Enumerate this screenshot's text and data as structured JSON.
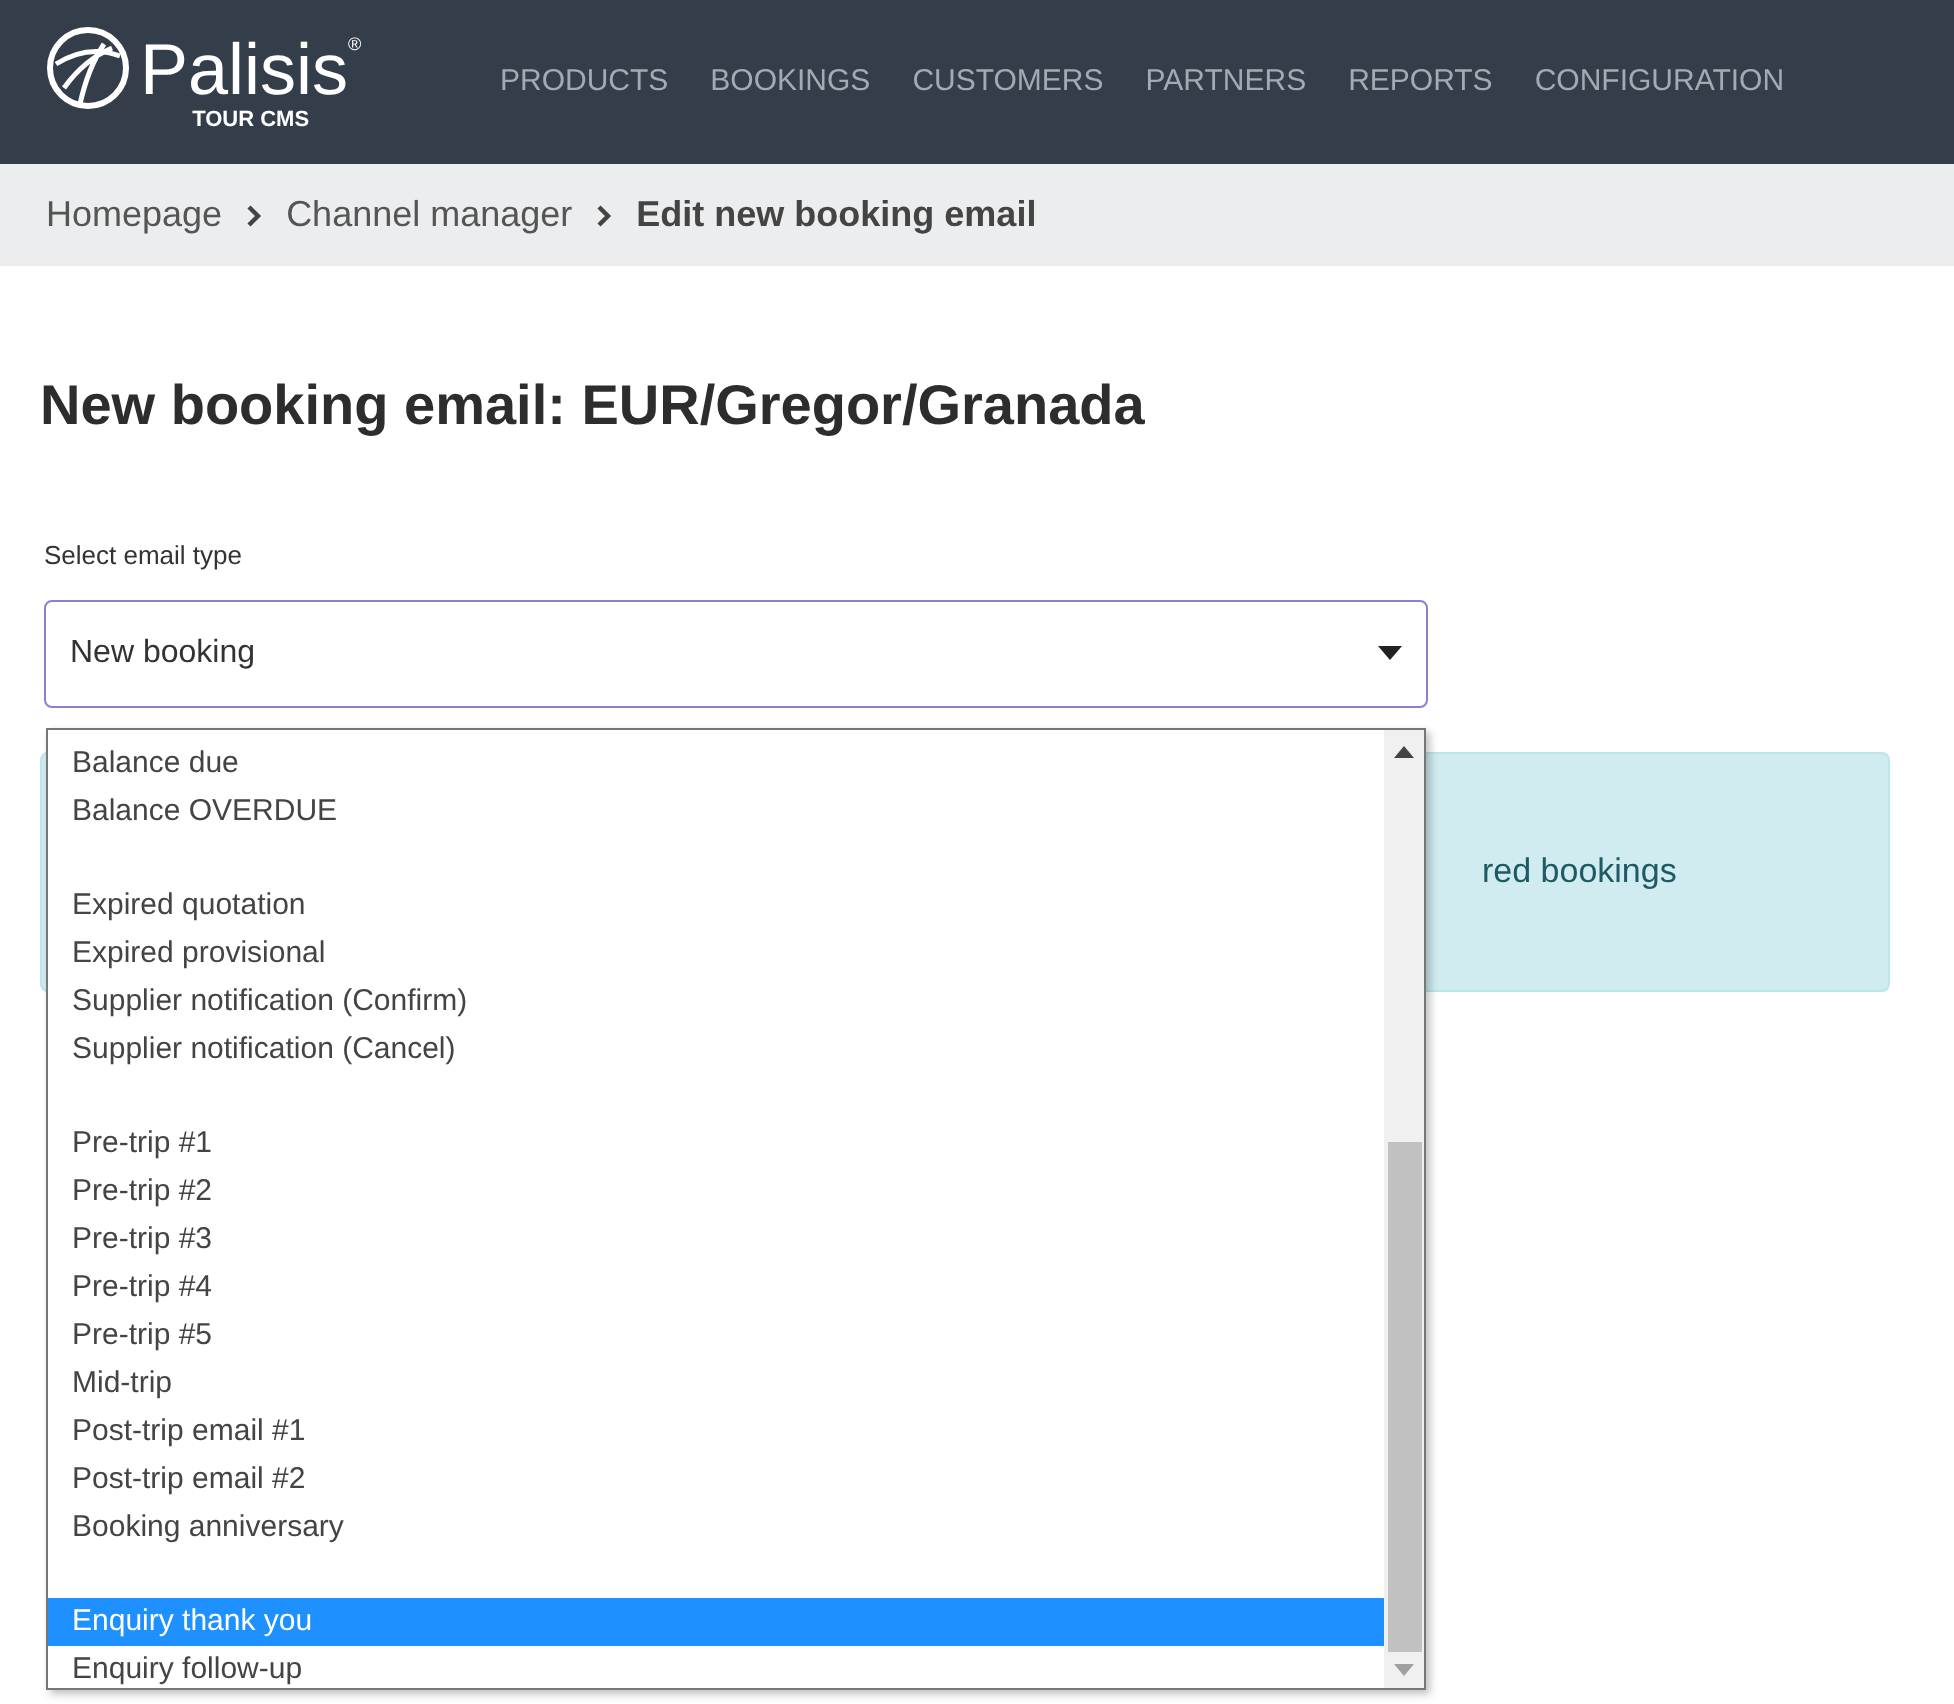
{
  "header": {
    "logo": {
      "name": "Palisis",
      "subtitle": "TOUR CMS",
      "mark": "®"
    },
    "nav": [
      {
        "label": "PRODUCTS"
      },
      {
        "label": "BOOKINGS"
      },
      {
        "label": "CUSTOMERS"
      },
      {
        "label": "PARTNERS"
      },
      {
        "label": "REPORTS"
      },
      {
        "label": "CONFIGURATION"
      }
    ]
  },
  "breadcrumb": [
    {
      "label": "Homepage",
      "current": false
    },
    {
      "label": "Channel manager",
      "current": false
    },
    {
      "label": "Edit new booking email",
      "current": true
    }
  ],
  "title": "New booking email: EUR/Gregor/Granada",
  "email_type": {
    "label": "Select email type",
    "value": "New booking",
    "expanded": true,
    "options": [
      {
        "kind": "option",
        "label": "Balance due",
        "selected": false
      },
      {
        "kind": "option",
        "label": "Balance OVERDUE",
        "selected": false
      },
      {
        "kind": "gap"
      },
      {
        "kind": "option",
        "label": "Expired quotation",
        "selected": false
      },
      {
        "kind": "option",
        "label": "Expired provisional",
        "selected": false
      },
      {
        "kind": "option",
        "label": "Supplier notification (Confirm)",
        "selected": false
      },
      {
        "kind": "option",
        "label": "Supplier notification (Cancel)",
        "selected": false
      },
      {
        "kind": "gap"
      },
      {
        "kind": "option",
        "label": "Pre-trip #1",
        "selected": false
      },
      {
        "kind": "option",
        "label": "Pre-trip #2",
        "selected": false
      },
      {
        "kind": "option",
        "label": "Pre-trip #3",
        "selected": false
      },
      {
        "kind": "option",
        "label": "Pre-trip #4",
        "selected": false
      },
      {
        "kind": "option",
        "label": "Pre-trip #5",
        "selected": false
      },
      {
        "kind": "option",
        "label": "Mid-trip",
        "selected": false
      },
      {
        "kind": "option",
        "label": "Post-trip email #1",
        "selected": false
      },
      {
        "kind": "option",
        "label": "Post-trip email #2",
        "selected": false
      },
      {
        "kind": "option",
        "label": "Booking anniversary",
        "selected": false
      },
      {
        "kind": "gap"
      },
      {
        "kind": "option",
        "label": "Enquiry thank you",
        "selected": true
      },
      {
        "kind": "option",
        "label": "Enquiry follow-up",
        "selected": false
      }
    ]
  },
  "info_box": {
    "text": "red bookings"
  }
}
